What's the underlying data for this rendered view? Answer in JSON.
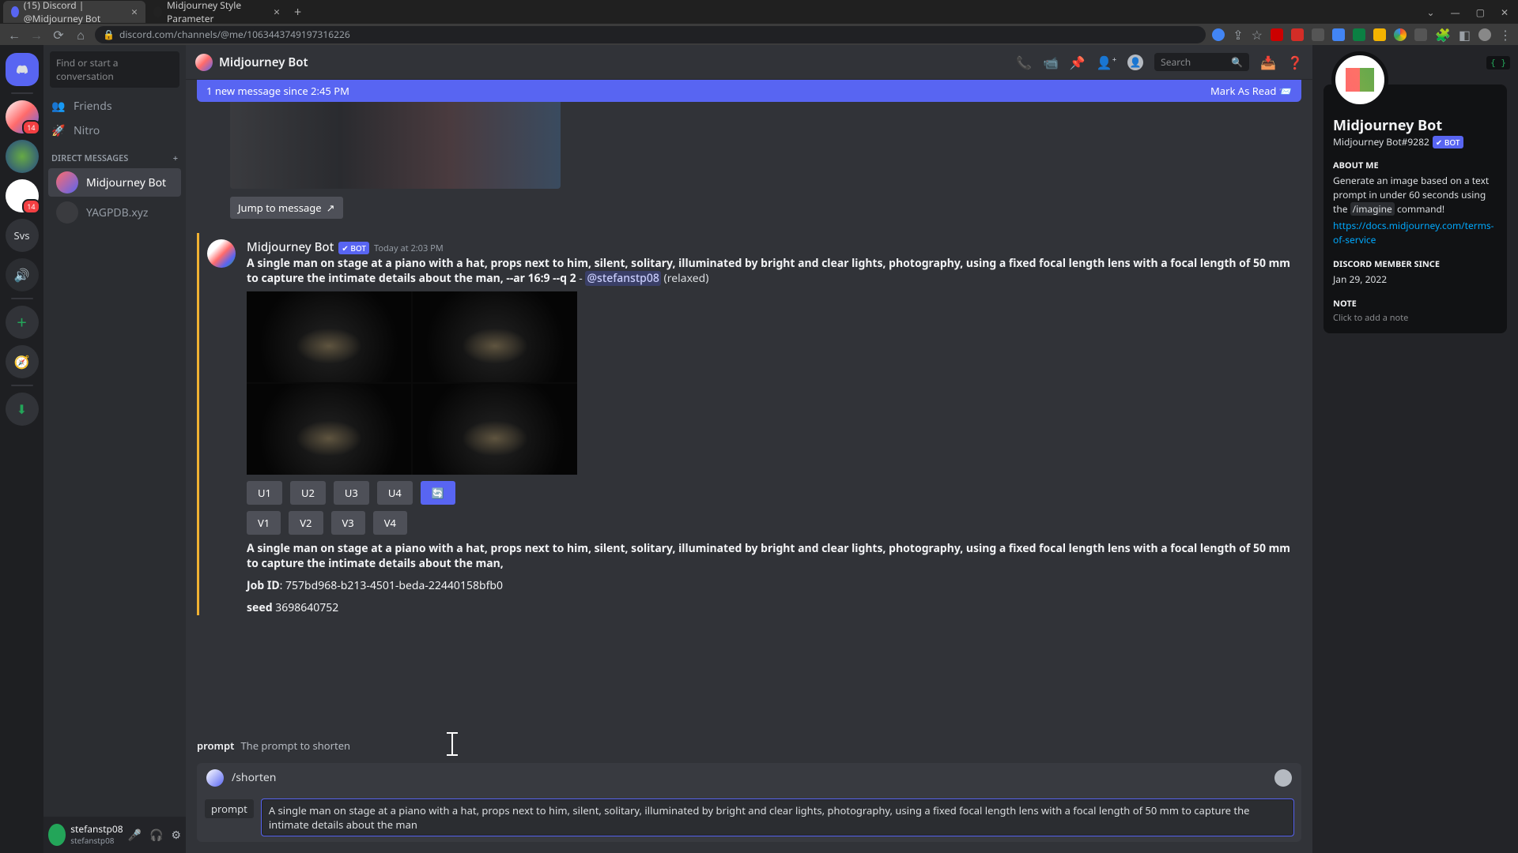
{
  "browser": {
    "tabs": [
      {
        "title": "(15) Discord | @Midjourney Bot",
        "active": true
      },
      {
        "title": "Midjourney Style Parameter",
        "active": false
      }
    ],
    "url": "discord.com/channels/@me/1063443749197316226"
  },
  "guilds": {
    "svs_label": "Svs",
    "badge_14": "14"
  },
  "channels": {
    "search_placeholder": "Find or start a conversation",
    "friends": "Friends",
    "nitro": "Nitro",
    "dm_header": "DIRECT MESSAGES",
    "dms": [
      {
        "name": "Midjourney Bot",
        "active": true
      },
      {
        "name": "YAGPDB.xyz",
        "active": false
      }
    ]
  },
  "user_area": {
    "name": "stefanstp08",
    "tag": "stefanstp08"
  },
  "header": {
    "title": "Midjourney Bot",
    "search_placeholder": "Search"
  },
  "new_msg_bar": {
    "text": "1 new message since 2:45 PM",
    "action": "Mark As Read"
  },
  "jump_button": "Jump to message",
  "message": {
    "author": "Midjourney Bot",
    "bot_tag": "✔ BOT",
    "timestamp": "Today at 2:03 PM",
    "prompt_bold": "A single man on stage at a piano with a hat, props next to him, silent, solitary, illuminated by bright and clear lights, photography, using a fixed focal length lens with a focal length of 50 mm to capture the intimate details about the man, --ar 16:9 --q 2",
    "dash": " - ",
    "mention": "@stefanstp08",
    "mode": " (relaxed)",
    "buttons_u": [
      "U1",
      "U2",
      "U3",
      "U4"
    ],
    "buttons_v": [
      "V1",
      "V2",
      "V3",
      "V4"
    ],
    "refresh": "🔄",
    "meta_prompt": "A single man on stage at a piano with a hat, props next to him, silent, solitary, illuminated by bright and clear lights, photography, using a fixed focal length lens with a focal length of 50 mm to capture the intimate details about the man,",
    "job_label": "Job ID",
    "job_id": ": 757bd968-b213-4501-beda-22440158bfb0",
    "seed_label": "seed",
    "seed": " 3698640752"
  },
  "slash_hint": {
    "label": "prompt",
    "desc": "The prompt to shorten"
  },
  "input": {
    "command": "/shorten",
    "param_label": "prompt",
    "value": "A single man on stage at a piano with a hat, props next to him, silent, solitary, illuminated by bright and clear lights, photography, using a fixed focal length lens with a focal length of 50 mm to capture the intimate details about the man"
  },
  "profile": {
    "name": "Midjourney Bot",
    "tag": "Midjourney Bot#9282",
    "bot_tag": "✔ BOT",
    "about_h": "ABOUT ME",
    "about_1": "Generate an image based on a text prompt in under 60 seconds using the ",
    "about_cmd": "/imagine",
    "about_2": " command!",
    "link": "https://docs.midjourney.com/terms-of-service",
    "since_h": "DISCORD MEMBER SINCE",
    "since": "Jan 29, 2022",
    "note_h": "NOTE",
    "note_placeholder": "Click to add a note",
    "brace": "{ }"
  }
}
